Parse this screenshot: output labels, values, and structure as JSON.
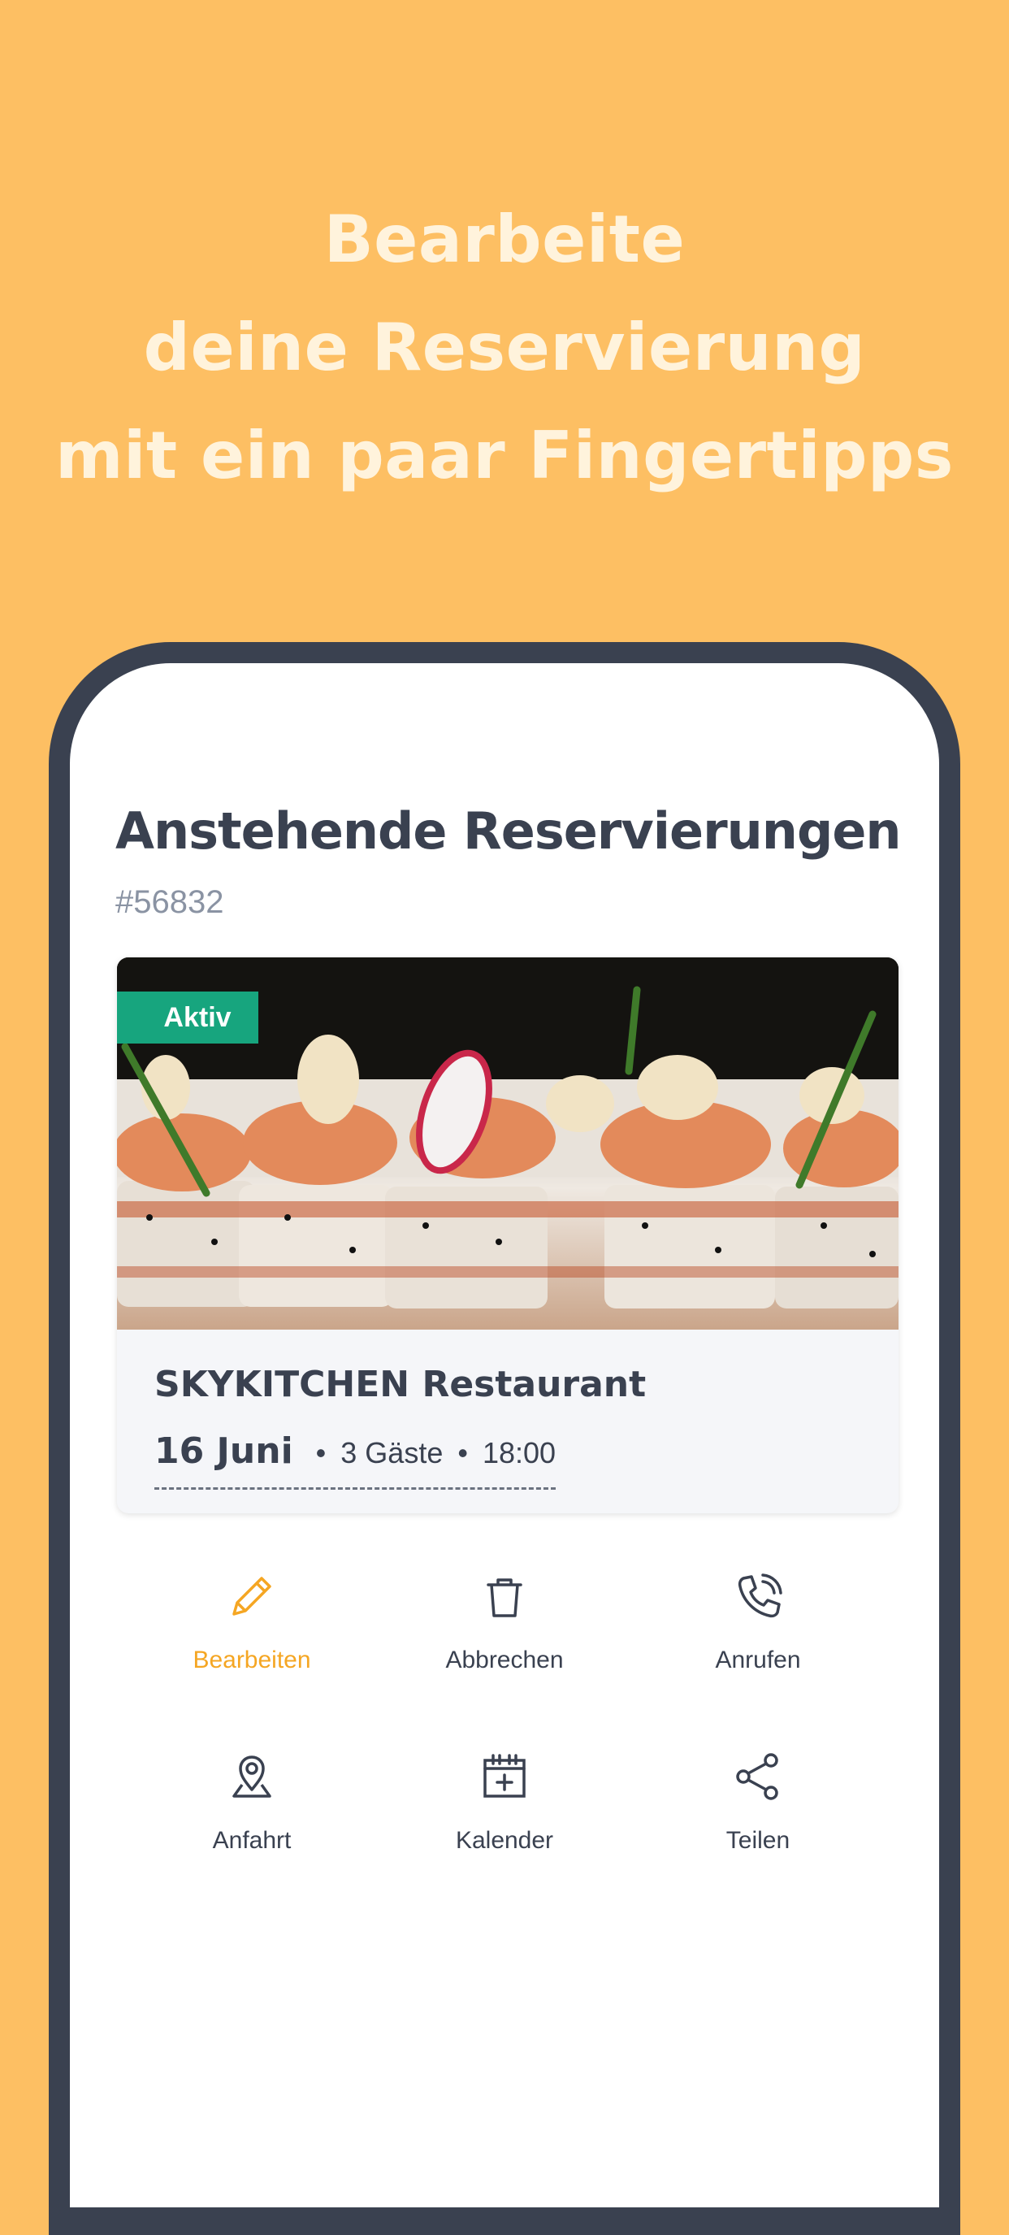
{
  "headline": {
    "line1": "Bearbeite",
    "line2": "deine Reservierung",
    "line3": "mit ein paar Fingertipps"
  },
  "colors": {
    "background": "#FDBF63",
    "headline": "#FFF3DC",
    "phone_frame": "#3A4150",
    "accent": "#F5A623",
    "badge": "#17A57E",
    "text": "#3A4150"
  },
  "screen": {
    "title": "Anstehende Reservierungen",
    "reservation_number": "#56832",
    "card": {
      "status_badge": "Aktiv",
      "image_description": "sushi-rolls-photo",
      "restaurant_name": "SKYKITCHEN Restaurant",
      "date": "16 Juni",
      "separator": "•",
      "guests": "3 Gäste",
      "time": "18:00"
    },
    "actions": [
      {
        "label": "Bearbeiten",
        "icon": "pencil-icon",
        "active": true
      },
      {
        "label": "Abbrechen",
        "icon": "trash-icon",
        "active": false
      },
      {
        "label": "Anrufen",
        "icon": "phone-icon",
        "active": false
      },
      {
        "label": "Anfahrt",
        "icon": "map-pin-icon",
        "active": false
      },
      {
        "label": "Kalender",
        "icon": "calendar-add-icon",
        "active": false
      },
      {
        "label": "Teilen",
        "icon": "share-icon",
        "active": false
      }
    ]
  }
}
